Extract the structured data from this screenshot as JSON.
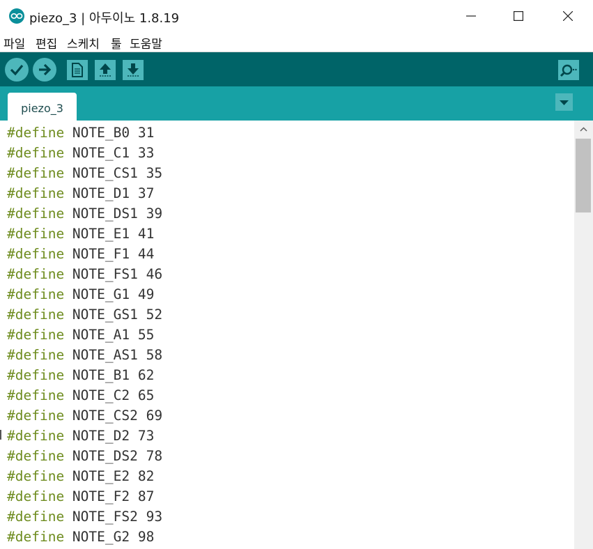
{
  "window": {
    "title": "piezo_3 | 아두이노 1.8.19",
    "controls": {
      "minimize": "minimize-icon",
      "maximize": "maximize-icon",
      "close": "close-icon"
    }
  },
  "menu": [
    "파일",
    "편집",
    "스케치",
    "툴",
    "도움말"
  ],
  "toolbar": {
    "buttons": [
      "verify-icon",
      "upload-icon",
      "new-icon",
      "open-icon",
      "save-icon",
      "serial-monitor-icon"
    ],
    "accent": "#006468",
    "button_color": "#4db7bb"
  },
  "tabs": [
    "piezo_3"
  ],
  "editor": {
    "keyword_color": "#6e8c1f",
    "lines": [
      {
        "kw": "#define",
        "rest": " NOTE_B0 31"
      },
      {
        "kw": "#define",
        "rest": " NOTE_C1 33"
      },
      {
        "kw": "#define",
        "rest": " NOTE_CS1 35"
      },
      {
        "kw": "#define",
        "rest": " NOTE_D1 37"
      },
      {
        "kw": "#define",
        "rest": " NOTE_DS1 39"
      },
      {
        "kw": "#define",
        "rest": " NOTE_E1 41"
      },
      {
        "kw": "#define",
        "rest": " NOTE_F1 44"
      },
      {
        "kw": "#define",
        "rest": " NOTE_FS1 46"
      },
      {
        "kw": "#define",
        "rest": " NOTE_G1 49"
      },
      {
        "kw": "#define",
        "rest": " NOTE_GS1 52"
      },
      {
        "kw": "#define",
        "rest": " NOTE_A1 55"
      },
      {
        "kw": "#define",
        "rest": " NOTE_AS1 58"
      },
      {
        "kw": "#define",
        "rest": " NOTE_B1 62"
      },
      {
        "kw": "#define",
        "rest": " NOTE_C2 65"
      },
      {
        "kw": "#define",
        "rest": " NOTE_CS2 69"
      },
      {
        "kw": "#define",
        "rest": " NOTE_D2 73"
      },
      {
        "kw": "#define",
        "rest": " NOTE_DS2 78"
      },
      {
        "kw": "#define",
        "rest": " NOTE_E2 82"
      },
      {
        "kw": "#define",
        "rest": " NOTE_F2 87"
      },
      {
        "kw": "#define",
        "rest": " NOTE_FS2 93"
      },
      {
        "kw": "#define",
        "rest": " NOTE_G2 98"
      }
    ]
  }
}
